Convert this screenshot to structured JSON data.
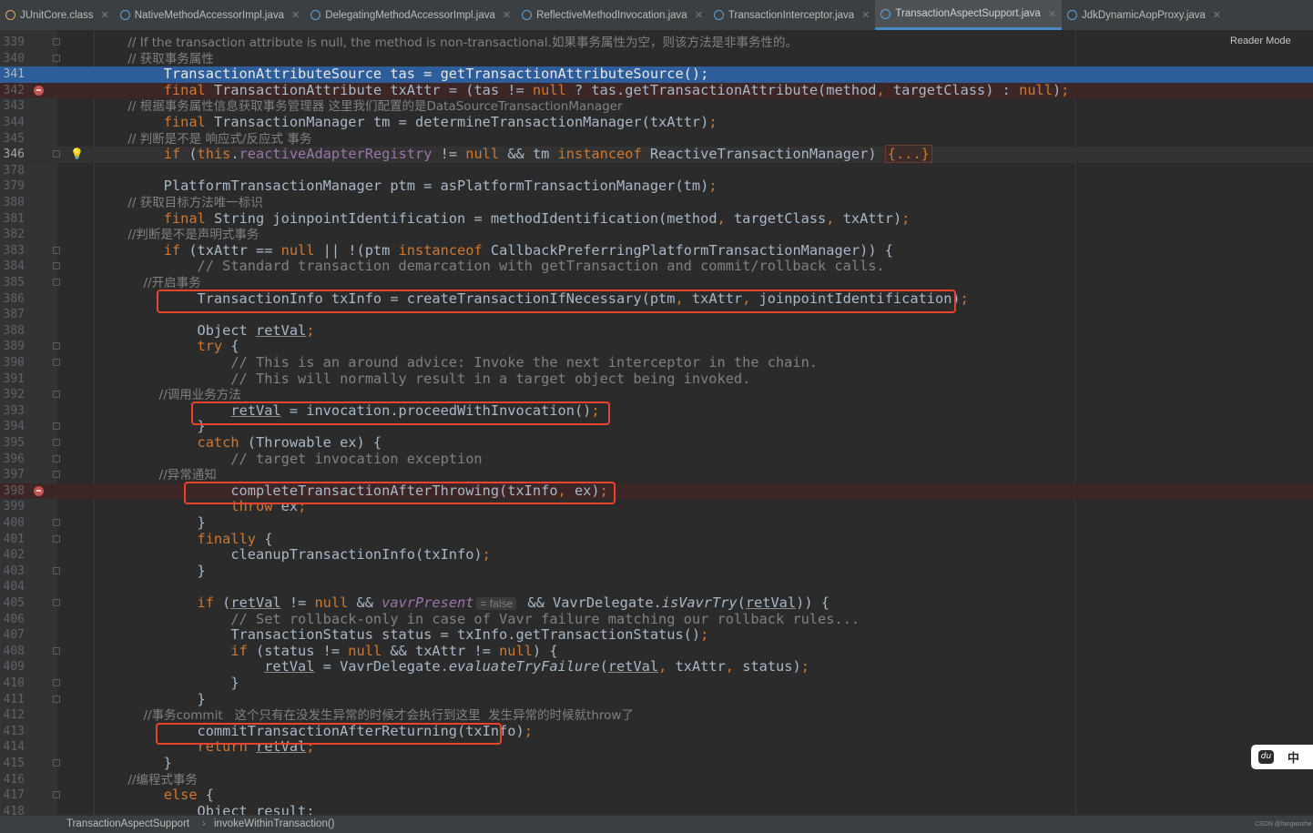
{
  "tabs": [
    {
      "label": "JUnitCore.class",
      "icon": "class-file-icon",
      "active": false
    },
    {
      "label": "NativeMethodAccessorImpl.java",
      "icon": "java-class-icon",
      "active": false
    },
    {
      "label": "DelegatingMethodAccessorImpl.java",
      "icon": "java-class-icon",
      "active": false
    },
    {
      "label": "ReflectiveMethodInvocation.java",
      "icon": "java-class-icon",
      "active": false
    },
    {
      "label": "TransactionInterceptor.java",
      "icon": "java-class-icon",
      "active": false
    },
    {
      "label": "TransactionAspectSupport.java",
      "icon": "java-class-icon",
      "active": true
    },
    {
      "label": "JdkDynamicAopProxy.java",
      "icon": "java-class-icon",
      "active": false
    }
  ],
  "reader_mode": "Reader Mode",
  "lines": [
    {
      "num": "339",
      "text": "        // If the transaction attribute is null, the method is non-transactional.如果事务属性为空，则该方法是非事务性的。"
    },
    {
      "num": "340",
      "text": "        // 获取事务属性"
    },
    {
      "num": "341",
      "text": "        TransactionAttributeSource tas = getTransactionAttributeSource();"
    },
    {
      "num": "342",
      "text": "        final TransactionAttribute txAttr = (tas != null ? tas.getTransactionAttribute(method, targetClass) : null);"
    },
    {
      "num": "343",
      "text": "        // 根据事务属性信息获取事务管理器 这里我们配置的是DataSourceTransactionManager"
    },
    {
      "num": "344",
      "text": "        final TransactionManager tm = determineTransactionManager(txAttr);"
    },
    {
      "num": "345",
      "text": "        // 判断是不是 响应式/反应式 事务"
    },
    {
      "num": "346",
      "text": "        if (this.reactiveAdapterRegistry != null && tm instanceof ReactiveTransactionManager) {...}"
    },
    {
      "num": "378",
      "text": ""
    },
    {
      "num": "379",
      "text": "        PlatformTransactionManager ptm = asPlatformTransactionManager(tm);"
    },
    {
      "num": "380",
      "text": "        // 获取目标方法唯一标识"
    },
    {
      "num": "381",
      "text": "        final String joinpointIdentification = methodIdentification(method, targetClass, txAttr);"
    },
    {
      "num": "382",
      "text": "        //判断是不是声明式事务"
    },
    {
      "num": "383",
      "text": "        if (txAttr == null || !(ptm instanceof CallbackPreferringPlatformTransactionManager)) {"
    },
    {
      "num": "384",
      "text": "            // Standard transaction demarcation with getTransaction and commit/rollback calls."
    },
    {
      "num": "385",
      "text": "            //开启事务"
    },
    {
      "num": "386",
      "text": "            TransactionInfo txInfo = createTransactionIfNecessary(ptm, txAttr, joinpointIdentification);"
    },
    {
      "num": "387",
      "text": ""
    },
    {
      "num": "388",
      "text": "            Object retVal;"
    },
    {
      "num": "389",
      "text": "            try {"
    },
    {
      "num": "390",
      "text": "                // This is an around advice: Invoke the next interceptor in the chain."
    },
    {
      "num": "391",
      "text": "                // This will normally result in a target object being invoked."
    },
    {
      "num": "392",
      "text": "                //调用业务方法"
    },
    {
      "num": "393",
      "text": "                retVal = invocation.proceedWithInvocation();"
    },
    {
      "num": "394",
      "text": "            }"
    },
    {
      "num": "395",
      "text": "            catch (Throwable ex) {"
    },
    {
      "num": "396",
      "text": "                // target invocation exception"
    },
    {
      "num": "397",
      "text": "                //异常通知"
    },
    {
      "num": "398",
      "text": "                completeTransactionAfterThrowing(txInfo, ex);"
    },
    {
      "num": "399",
      "text": "                throw ex;"
    },
    {
      "num": "400",
      "text": "            }"
    },
    {
      "num": "401",
      "text": "            finally {"
    },
    {
      "num": "402",
      "text": "                cleanupTransactionInfo(txInfo);"
    },
    {
      "num": "403",
      "text": "            }"
    },
    {
      "num": "404",
      "text": ""
    },
    {
      "num": "405",
      "text": "            if (retVal != null && vavrPresent = false && VavrDelegate.isVavrTry(retVal)) {"
    },
    {
      "num": "406",
      "text": "                // Set rollback-only in case of Vavr failure matching our rollback rules..."
    },
    {
      "num": "407",
      "text": "                TransactionStatus status = txInfo.getTransactionStatus();"
    },
    {
      "num": "408",
      "text": "                if (status != null && txAttr != null) {"
    },
    {
      "num": "409",
      "text": "                    retVal = VavrDelegate.evaluateTryFailure(retVal, txAttr, status);"
    },
    {
      "num": "410",
      "text": "                }"
    },
    {
      "num": "411",
      "text": "            }"
    },
    {
      "num": "412",
      "text": "            //事务commit   这个只有在没发生异常的时候才会执行到这里  发生异常的时候就throw了"
    },
    {
      "num": "413",
      "text": "            commitTransactionAfterReturning(txInfo);"
    },
    {
      "num": "414",
      "text": "            return retVal;"
    },
    {
      "num": "415",
      "text": "        }"
    },
    {
      "num": "416",
      "text": "        //编程式事务"
    },
    {
      "num": "417",
      "text": "        else {"
    },
    {
      "num": "418",
      "text": "            Object result;"
    }
  ],
  "breadcrumb": {
    "class_name": "TransactionAspectSupport",
    "method_name": "invokeWithinTransaction()"
  },
  "watermark": "CSDN @fangwuzhe",
  "ime": {
    "logo": "du",
    "mode": "中"
  },
  "colors": {
    "keyword": "#cc7832",
    "comment": "#808080",
    "field": "#9876aa",
    "selection": "#2d5d9b",
    "breakpoint": "#c75450",
    "highlight_box": "#e8432d"
  }
}
